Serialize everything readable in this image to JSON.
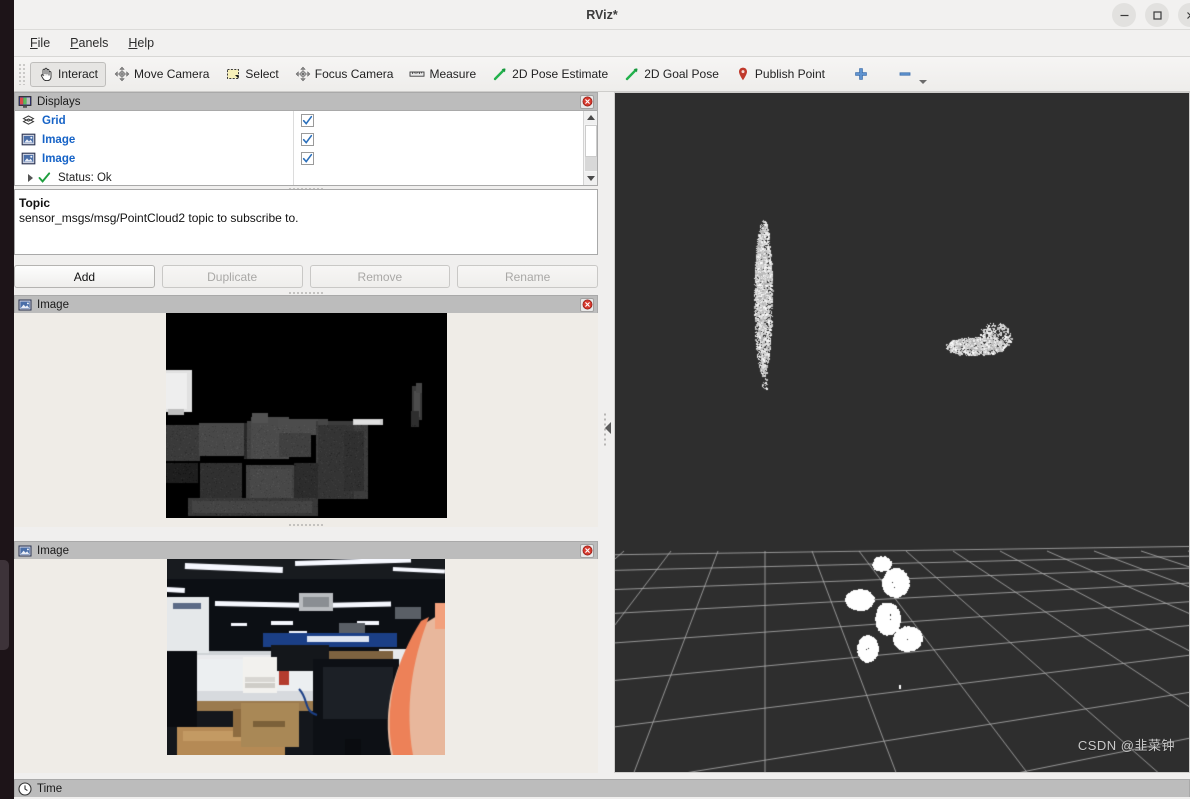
{
  "window": {
    "title": "RViz*",
    "controls": [
      {
        "name": "minimize",
        "glyph": "–"
      },
      {
        "name": "maximize",
        "glyph": "□"
      },
      {
        "name": "close",
        "glyph": "✕"
      }
    ]
  },
  "menubar": {
    "items": [
      {
        "label": "File",
        "mnemonic": "F"
      },
      {
        "label": "Panels",
        "mnemonic": "P"
      },
      {
        "label": "Help",
        "mnemonic": "H"
      }
    ]
  },
  "toolbar": {
    "buttons": [
      {
        "label": "Interact",
        "icon": "hand-cursor-icon",
        "active": true
      },
      {
        "label": "Move Camera",
        "icon": "move-camera-icon",
        "active": false
      },
      {
        "label": "Select",
        "icon": "select-rectangle-icon",
        "active": false
      },
      {
        "label": "Focus Camera",
        "icon": "focus-camera-icon",
        "active": false
      },
      {
        "label": "Measure",
        "icon": "ruler-icon",
        "active": false
      },
      {
        "label": "2D Pose Estimate",
        "icon": "green-arrow-icon",
        "active": false
      },
      {
        "label": "2D Goal Pose",
        "icon": "green-arrow-icon",
        "active": false
      },
      {
        "label": "Publish Point",
        "icon": "map-pin-icon",
        "active": false
      },
      {
        "label": "",
        "icon": "plus-icon",
        "active": false
      },
      {
        "label": "",
        "icon": "minus-icon",
        "active": false
      }
    ]
  },
  "displays_panel": {
    "title": "Displays",
    "title_icon": "displays-monitor-icon",
    "close_icon": "close-icon",
    "tree": [
      {
        "label": "Grid",
        "icon": "grid-icon",
        "checked": true,
        "indent": 0
      },
      {
        "label": "Image",
        "icon": "image-icon",
        "checked": true,
        "indent": 0
      },
      {
        "label": "Image",
        "icon": "image-icon",
        "checked": true,
        "indent": 0
      },
      {
        "label": "Status: Ok",
        "icon": "status-ok-icon",
        "checked": null,
        "indent": 1
      }
    ],
    "help": {
      "title": "Topic",
      "text": "sensor_msgs/msg/PointCloud2 topic to subscribe to."
    },
    "buttons": [
      {
        "label": "Add",
        "enabled": true
      },
      {
        "label": "Duplicate",
        "enabled": false
      },
      {
        "label": "Remove",
        "enabled": false
      },
      {
        "label": "Rename",
        "enabled": false
      }
    ]
  },
  "image_panel_1": {
    "title": "Image",
    "title_icon": "image-icon",
    "close_icon": "close-icon",
    "content": "depth-image-office-scene"
  },
  "image_panel_2": {
    "title": "Image",
    "title_icon": "image-icon",
    "close_icon": "close-icon",
    "content": "rgb-camera-office-scene"
  },
  "view3d": {
    "name": "3d-render-view",
    "background_color": "#2e2e2e",
    "grid_color": "#a5a5a5",
    "point_color": "#ffffff"
  },
  "time_panel": {
    "title": "Time",
    "title_icon": "clock-icon"
  },
  "watermark": {
    "text": "CSDN @韭菜钟"
  },
  "colors": {
    "tree_label": "#1663c7",
    "checkbox_check": "#2a6fbb",
    "close_red": "#d83a2e",
    "green_arrow": "#22b14c",
    "pin_red": "#c0392b",
    "plus_blue": "#4a86c8"
  }
}
